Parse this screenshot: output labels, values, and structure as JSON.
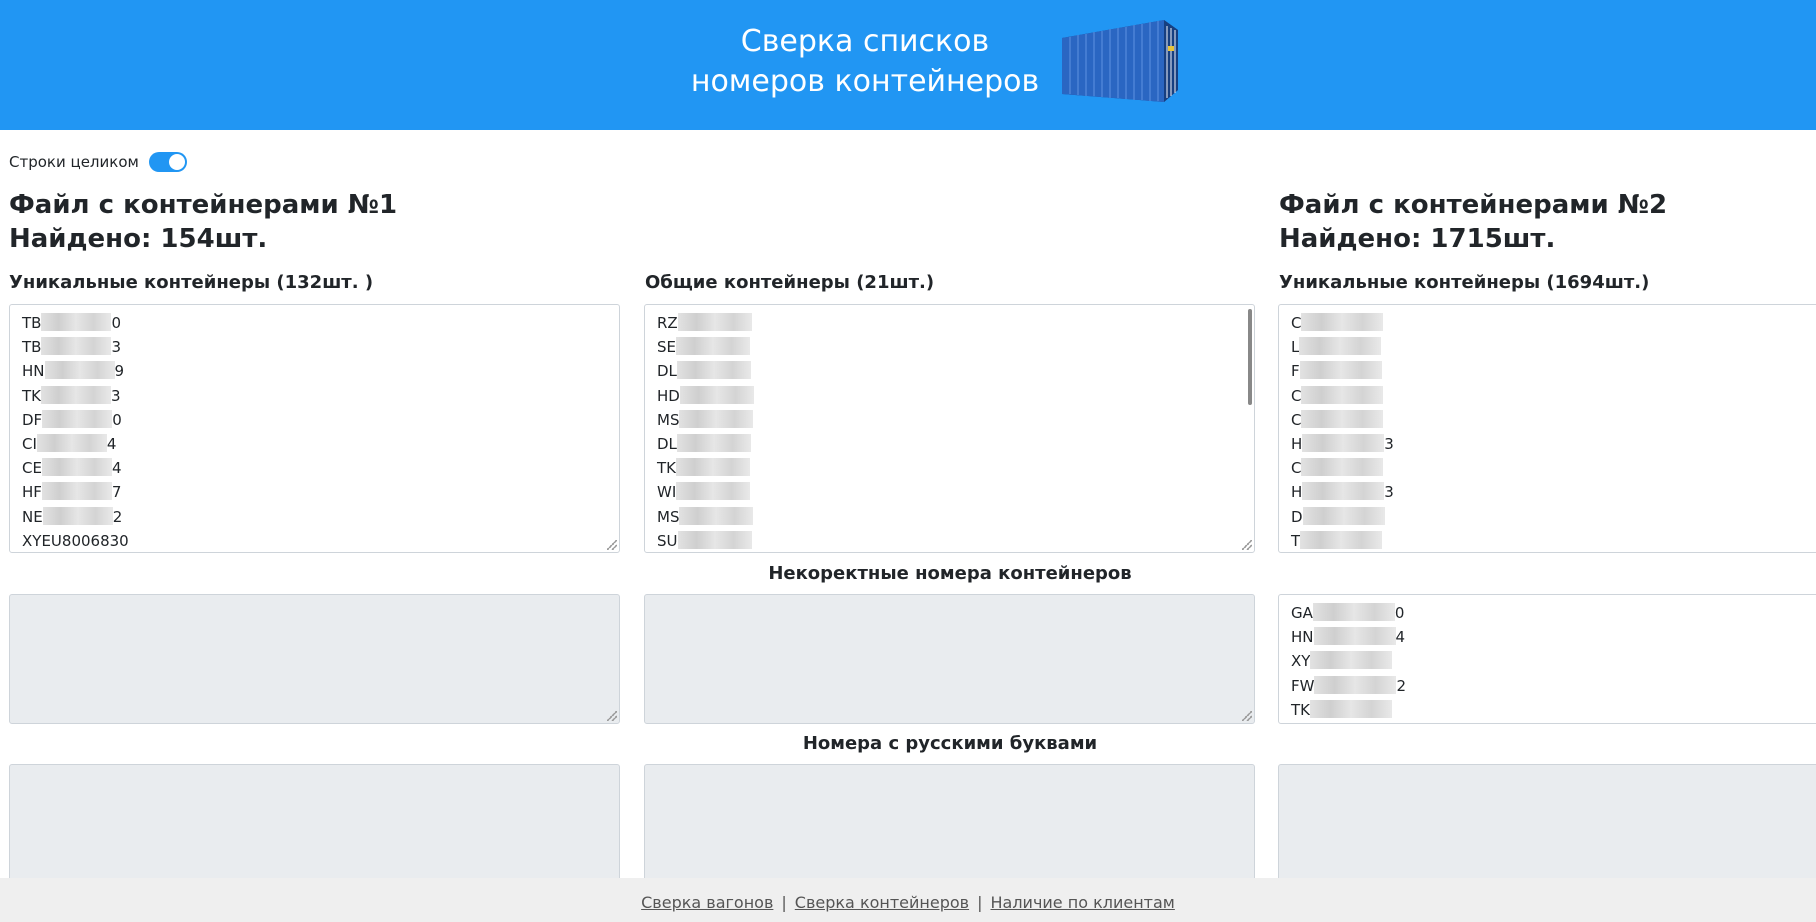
{
  "header": {
    "title_line1": "Сверка списков",
    "title_line2": "номеров контейнеров",
    "logo_icon": "shipping-container-icon",
    "brand_color": "#2196f3"
  },
  "toggle": {
    "label": "Строки целиком",
    "on": true
  },
  "file1": {
    "title": "Файл с контейнерами №1",
    "found": "Найдено: 154шт."
  },
  "file2": {
    "title": "Файл с контейнерами №2",
    "found": "Найдено: 1715шт."
  },
  "columns": {
    "unique1_label": "Уникальные контейнеры (132шт. )",
    "common_label": "Общие контейнеры (21шт.)",
    "unique2_label": "Уникальные контейнеры (1694шт.)"
  },
  "sections": {
    "incorrect_title": "Некоректные номера контейнеров",
    "russian_title": "Номера с русскими буквами"
  },
  "lists": {
    "unique1": [
      {
        "pre": "TB",
        "post": "0"
      },
      {
        "pre": "TB",
        "post": "3"
      },
      {
        "pre": "HN",
        "post": "9"
      },
      {
        "pre": "TK",
        "post": "3"
      },
      {
        "pre": "DF",
        "post": "0"
      },
      {
        "pre": "CI",
        "post": "4"
      },
      {
        "pre": "CE",
        "post": "4"
      },
      {
        "pre": "HF",
        "post": "7"
      },
      {
        "pre": "NE",
        "post": "2"
      },
      {
        "pre": "XYEU8006830",
        "post": ""
      }
    ],
    "common": [
      {
        "pre": "RZ",
        "post": ""
      },
      {
        "pre": "SE",
        "post": ""
      },
      {
        "pre": "DL",
        "post": ""
      },
      {
        "pre": "HD",
        "post": ""
      },
      {
        "pre": "MS",
        "post": ""
      },
      {
        "pre": "DL",
        "post": ""
      },
      {
        "pre": "TK",
        "post": ""
      },
      {
        "pre": "WI",
        "post": ""
      },
      {
        "pre": "MS",
        "post": ""
      },
      {
        "pre": "SU",
        "post": ""
      }
    ],
    "unique2": [
      {
        "pre": "C",
        "post": ""
      },
      {
        "pre": "L",
        "post": ""
      },
      {
        "pre": "F",
        "post": ""
      },
      {
        "pre": "C",
        "post": ""
      },
      {
        "pre": "C",
        "post": ""
      },
      {
        "pre": "H",
        "post": "3"
      },
      {
        "pre": "C",
        "post": ""
      },
      {
        "pre": "H",
        "post": "3"
      },
      {
        "pre": "D",
        "post": ""
      },
      {
        "pre": "T",
        "post": ""
      }
    ],
    "incorrect2": [
      {
        "pre": "GA",
        "post": "0"
      },
      {
        "pre": "HN",
        "post": "4"
      },
      {
        "pre": "XY",
        "post": ""
      },
      {
        "pre": "FW",
        "post": "2"
      },
      {
        "pre": "TK",
        "post": ""
      }
    ]
  },
  "footer": {
    "link1": "Сверка вагонов",
    "link2": "Сверка контейнеров",
    "link3": "Наличие по клиентам",
    "separator": "|"
  }
}
